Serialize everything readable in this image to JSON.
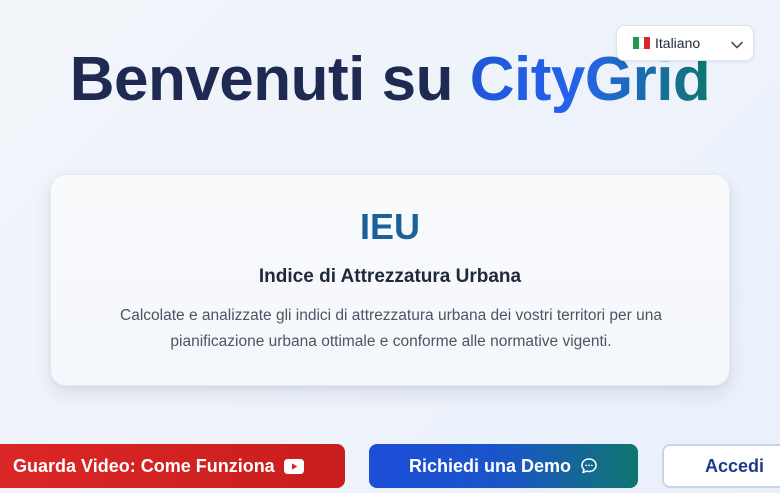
{
  "header": {
    "title_prefix": "Benvenuti su",
    "brand_name": "CityGrid"
  },
  "language_select": {
    "selected": "Italiano",
    "flag": "italian-flag"
  },
  "card": {
    "abbreviation": "IEU",
    "title": "Indice di Attrezzatura Urbana",
    "description_line1": "Calcolate e analizzate gli indici di attrezzatura urbana dei vostri territori per una",
    "description_line2": "pianificazione urbana ottimale e conforme alle normative vigenti."
  },
  "actions": {
    "video_label": "Guarda Video: Come Funziona",
    "video_icon": "youtube-icon",
    "demo_label": "Richiedi una Demo",
    "demo_icon": "chat-bubble-icon",
    "login_label": "Accedi"
  },
  "colors": {
    "title_dark": "#1e2a52",
    "brand_blue": "#2563eb",
    "brand_teal": "#0f766e",
    "video_red": "#dc2626",
    "login_text": "#1e3a8a"
  }
}
